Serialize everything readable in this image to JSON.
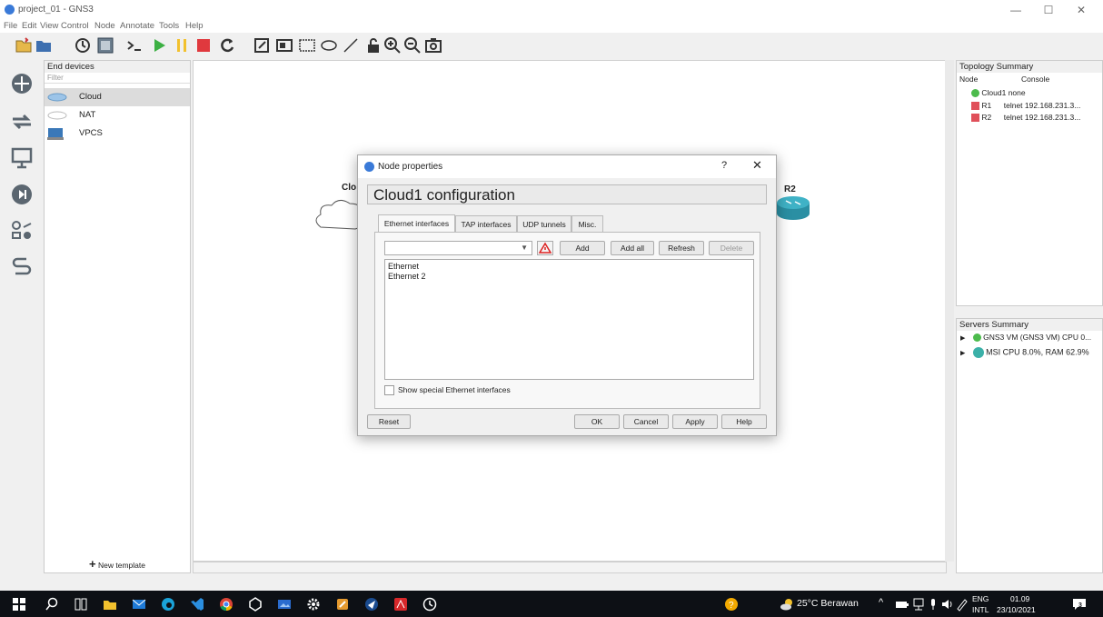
{
  "window": {
    "title": "project_01 - GNS3",
    "min_glyph": "—",
    "max_glyph": "☐",
    "close_glyph": "✕"
  },
  "menu": [
    "File",
    "Edit",
    "View",
    "Control",
    "Node",
    "Annotate",
    "Tools",
    "Help"
  ],
  "devices_panel": {
    "title": "End devices",
    "filter_placeholder": "Filter",
    "items": [
      {
        "label": "Cloud",
        "selected": true
      },
      {
        "label": "NAT",
        "selected": false
      },
      {
        "label": "VPCS",
        "selected": false
      }
    ],
    "new_template": "New template"
  },
  "canvas": {
    "node_cloud_label": "Clo",
    "node_r2_label": "R2"
  },
  "topology_summary": {
    "title": "Topology Summary",
    "columns": [
      "Node",
      "Console"
    ],
    "rows": [
      {
        "node": "Cloud1",
        "console": "none",
        "status": "started"
      },
      {
        "node": "R1",
        "console": "telnet 192.168.231.3...",
        "status": "stopped"
      },
      {
        "node": "R2",
        "console": "telnet 192.168.231.3...",
        "status": "stopped"
      }
    ]
  },
  "servers_summary": {
    "title": "Servers Summary",
    "rows": [
      {
        "label": "GNS3 VM (GNS3 VM) CPU 0..."
      },
      {
        "label": "MSI CPU 8.0%, RAM 62.9%"
      }
    ]
  },
  "dialog": {
    "title": "Node properties",
    "help_glyph": "?",
    "close_glyph": "✕",
    "heading": "Cloud1 configuration",
    "tabs": [
      "Ethernet interfaces",
      "TAP interfaces",
      "UDP tunnels",
      "Misc."
    ],
    "active_tab": "Ethernet interfaces",
    "combo_value": "",
    "buttons": {
      "add": "Add",
      "add_all": "Add all",
      "refresh": "Refresh",
      "delete": "Delete"
    },
    "interfaces": [
      "Ethernet",
      "Ethernet 2"
    ],
    "show_special_label": "Show special Ethernet interfaces",
    "show_special_checked": false,
    "footer": {
      "reset": "Reset",
      "ok": "OK",
      "cancel": "Cancel",
      "apply": "Apply",
      "help": "Help"
    }
  },
  "taskbar": {
    "weather": "25°C Berawan",
    "lang_top": "ENG",
    "lang_bottom": "INTL",
    "time": "01.09",
    "date": "23/10/2021",
    "notification_count": "3"
  }
}
